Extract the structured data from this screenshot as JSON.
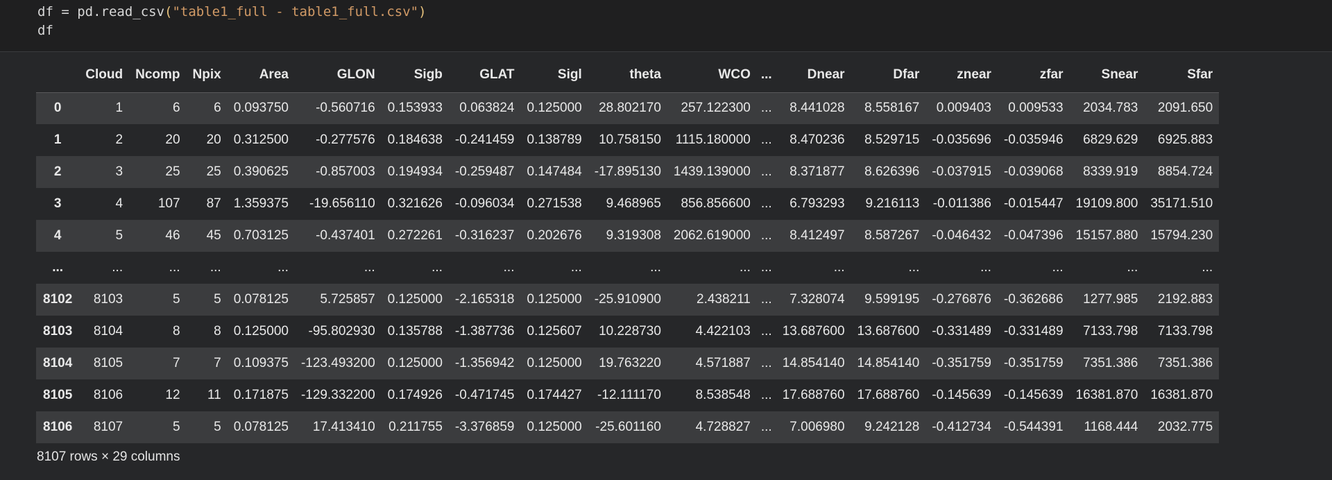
{
  "code": {
    "line1": {
      "prefix": "df = pd.read_csv",
      "open_paren": "(",
      "string": "\"table1_full - table1_full.csv\"",
      "close_paren": ")"
    },
    "line2": "df"
  },
  "dataframe": {
    "columns": [
      "",
      "Cloud",
      "Ncomp",
      "Npix",
      "Area",
      "GLON",
      "Sigb",
      "GLAT",
      "Sigl",
      "theta",
      "WCO",
      "...",
      "Dnear",
      "Dfar",
      "znear",
      "zfar",
      "Snear",
      "Sfar"
    ],
    "rows": [
      [
        "0",
        "1",
        "6",
        "6",
        "0.093750",
        "-0.560716",
        "0.153933",
        "0.063824",
        "0.125000",
        "28.802170",
        "257.122300",
        "...",
        "8.441028",
        "8.558167",
        "0.009403",
        "0.009533",
        "2034.783",
        "2091.650"
      ],
      [
        "1",
        "2",
        "20",
        "20",
        "0.312500",
        "-0.277576",
        "0.184638",
        "-0.241459",
        "0.138789",
        "10.758150",
        "1115.180000",
        "...",
        "8.470236",
        "8.529715",
        "-0.035696",
        "-0.035946",
        "6829.629",
        "6925.883"
      ],
      [
        "2",
        "3",
        "25",
        "25",
        "0.390625",
        "-0.857003",
        "0.194934",
        "-0.259487",
        "0.147484",
        "-17.895130",
        "1439.139000",
        "...",
        "8.371877",
        "8.626396",
        "-0.037915",
        "-0.039068",
        "8339.919",
        "8854.724"
      ],
      [
        "3",
        "4",
        "107",
        "87",
        "1.359375",
        "-19.656110",
        "0.321626",
        "-0.096034",
        "0.271538",
        "9.468965",
        "856.856600",
        "...",
        "6.793293",
        "9.216113",
        "-0.011386",
        "-0.015447",
        "19109.800",
        "35171.510"
      ],
      [
        "4",
        "5",
        "46",
        "45",
        "0.703125",
        "-0.437401",
        "0.272261",
        "-0.316237",
        "0.202676",
        "9.319308",
        "2062.619000",
        "...",
        "8.412497",
        "8.587267",
        "-0.046432",
        "-0.047396",
        "15157.880",
        "15794.230"
      ],
      [
        "...",
        "...",
        "...",
        "...",
        "...",
        "...",
        "...",
        "...",
        "...",
        "...",
        "...",
        "...",
        "...",
        "...",
        "...",
        "...",
        "...",
        "..."
      ],
      [
        "8102",
        "8103",
        "5",
        "5",
        "0.078125",
        "5.725857",
        "0.125000",
        "-2.165318",
        "0.125000",
        "-25.910900",
        "2.438211",
        "...",
        "7.328074",
        "9.599195",
        "-0.276876",
        "-0.362686",
        "1277.985",
        "2192.883"
      ],
      [
        "8103",
        "8104",
        "8",
        "8",
        "0.125000",
        "-95.802930",
        "0.135788",
        "-1.387736",
        "0.125607",
        "10.228730",
        "4.422103",
        "...",
        "13.687600",
        "13.687600",
        "-0.331489",
        "-0.331489",
        "7133.798",
        "7133.798"
      ],
      [
        "8104",
        "8105",
        "7",
        "7",
        "0.109375",
        "-123.493200",
        "0.125000",
        "-1.356942",
        "0.125000",
        "19.763220",
        "4.571887",
        "...",
        "14.854140",
        "14.854140",
        "-0.351759",
        "-0.351759",
        "7351.386",
        "7351.386"
      ],
      [
        "8105",
        "8106",
        "12",
        "11",
        "0.171875",
        "-129.332200",
        "0.174926",
        "-0.471745",
        "0.174427",
        "-12.111170",
        "8.538548",
        "...",
        "17.688760",
        "17.688760",
        "-0.145639",
        "-0.145639",
        "16381.870",
        "16381.870"
      ],
      [
        "8106",
        "8107",
        "5",
        "5",
        "0.078125",
        "17.413410",
        "0.211755",
        "-3.376859",
        "0.125000",
        "-25.601160",
        "4.728827",
        "...",
        "7.006980",
        "9.242128",
        "-0.412734",
        "-0.544391",
        "1168.444",
        "2032.775"
      ]
    ]
  },
  "shape_text": "8107 rows × 29 columns",
  "colors": {
    "background": "#262729",
    "code_background": "#1f1f20",
    "row_stripe": "#3b3c3e",
    "string": "#d19a66",
    "paren": "#e5c07b"
  }
}
